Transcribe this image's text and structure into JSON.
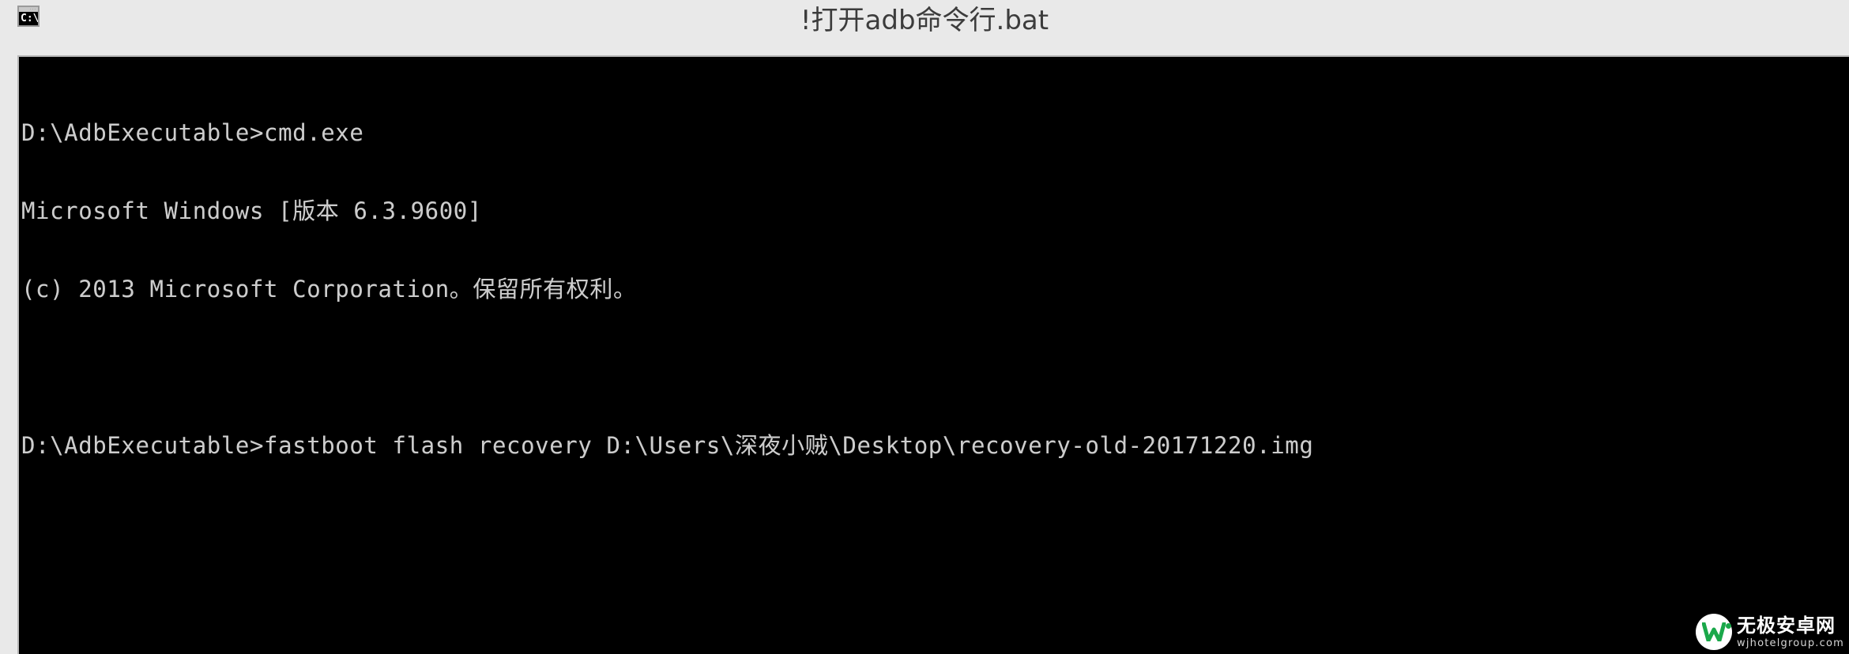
{
  "window": {
    "title": "!打开adb命令行.bat",
    "icon_name": "console-icon",
    "icon_prompt": "C:\\.",
    "icon_dots": "···",
    "background_color": "#e9e9e9"
  },
  "terminal": {
    "background_color": "#000000",
    "text_color": "#cccccc",
    "lines": [
      "D:\\AdbExecutable>cmd.exe",
      "Microsoft Windows [版本 6.3.9600]",
      "(c) 2013 Microsoft Corporation。保留所有权利。",
      "",
      "D:\\AdbExecutable>fastboot flash recovery D:\\Users\\深夜小贼\\Desktop\\recovery-old-20171220.img"
    ]
  },
  "watermark": {
    "brand_name": "无极安卓网",
    "url": "wjhotelgroup.com",
    "logo_color": "#1aa84a"
  }
}
